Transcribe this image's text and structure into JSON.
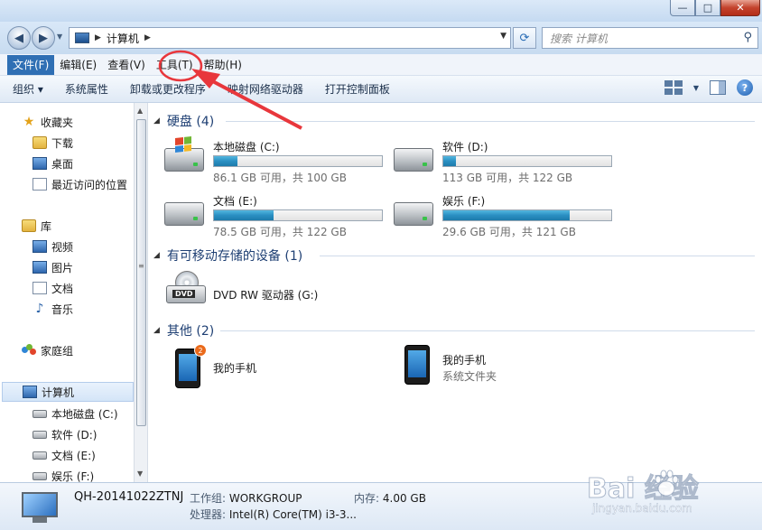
{
  "window": {
    "controls": {
      "minimize": "—",
      "maximize": "□",
      "close": "✕"
    }
  },
  "nav": {
    "back_glyph": "◀",
    "forward_glyph": "▶",
    "dropdown_glyph": "▼",
    "address_sep": "▶",
    "address_text": "计算机",
    "address_tail": "▶",
    "refresh_glyph": "⟳",
    "search_placeholder": "搜索 计算机",
    "search_glyph": "⚲"
  },
  "menu": [
    {
      "label": "文件(F)",
      "active": true
    },
    {
      "label": "编辑(E)"
    },
    {
      "label": "查看(V)"
    },
    {
      "label": "工具(T)"
    },
    {
      "label": "帮助(H)"
    }
  ],
  "commands": {
    "organize": "组织 ▾",
    "items": [
      "系统属性",
      "卸载或更改程序",
      "映射网络驱动器",
      "打开控制面板"
    ],
    "help": "?"
  },
  "sidebar": {
    "favorites": {
      "label": "收藏夹",
      "items": [
        "下载",
        "桌面",
        "最近访问的位置"
      ]
    },
    "libraries": {
      "label": "库",
      "items": [
        "视频",
        "图片",
        "文档",
        "音乐"
      ]
    },
    "homegroup": "家庭组",
    "computer": {
      "label": "计算机",
      "items": [
        "本地磁盘 (C:)",
        "软件 (D:)",
        "文档 (E:)",
        "娱乐 (F:)"
      ]
    }
  },
  "content": {
    "groups": {
      "hdd": "硬盘 (4)",
      "removable": "有可移动存储的设备 (1)",
      "other": "其他 (2)"
    },
    "drives": [
      {
        "name": "本地磁盘 (C:)",
        "free": "86.1 GB 可用，共 100 GB",
        "used_fraction": 0.139
      },
      {
        "name": "软件 (D:)",
        "free": "113 GB 可用，共 122 GB",
        "used_fraction": 0.074
      },
      {
        "name": "文档 (E:)",
        "free": "78.5 GB 可用，共 122 GB",
        "used_fraction": 0.357
      },
      {
        "name": "娱乐 (F:)",
        "free": "29.6 GB 可用，共 121 GB",
        "used_fraction": 0.755
      }
    ],
    "dvd": {
      "name": "DVD RW 驱动器 (G:)",
      "label": "DVD"
    },
    "others": [
      {
        "name": "我的手机",
        "badge": "2"
      },
      {
        "name": "我的手机",
        "sub": "系统文件夹"
      }
    ]
  },
  "details": {
    "computer_name": "QH-20141022ZTNJ",
    "workgroup_label": "工作组:",
    "workgroup": "WORKGROUP",
    "memory_label": "内存:",
    "memory": "4.00 GB",
    "cpu_label": "处理器:",
    "cpu": "Intel(R) Core(TM) i3-3..."
  },
  "watermark": {
    "logo": "Bai  经验",
    "url": "jingyan.baidu.com"
  },
  "colors": {
    "accent": "#2f6fb4",
    "group_heading": "#1e3f73",
    "annotation": "#e8373c",
    "drive_bar": "#2a8fc2"
  }
}
